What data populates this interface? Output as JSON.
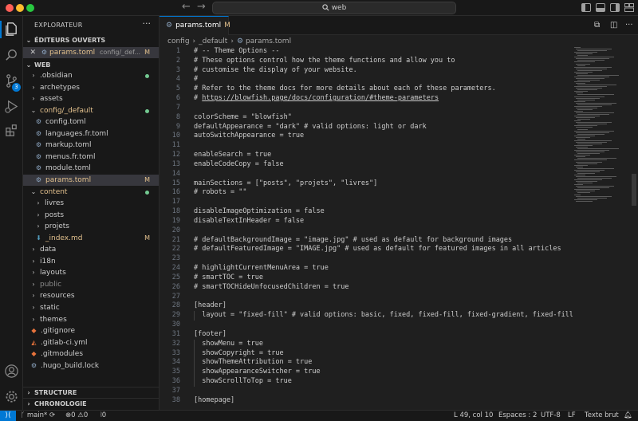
{
  "title_bar": {
    "search_text": "web"
  },
  "activity_bar": {
    "scm_badge": "3"
  },
  "sidebar": {
    "header": "EXPLORATEUR",
    "more": "···",
    "open_editors": {
      "title": "ÉDITEURS OUVERTS",
      "items": [
        {
          "name": "params.toml",
          "path": "config/_def...",
          "status": "M"
        }
      ]
    },
    "workspace": {
      "title": "WEB",
      "tree": [
        {
          "name": ".obsidian",
          "kind": "folder",
          "dot": true
        },
        {
          "name": "archetypes",
          "kind": "folder"
        },
        {
          "name": "assets",
          "kind": "folder"
        },
        {
          "name": "config/_default",
          "kind": "folder-open",
          "dot": true,
          "modified": true
        },
        {
          "name": "config.toml",
          "kind": "file",
          "level": 1
        },
        {
          "name": "languages.fr.toml",
          "kind": "file",
          "level": 1
        },
        {
          "name": "markup.toml",
          "kind": "file",
          "level": 1
        },
        {
          "name": "menus.fr.toml",
          "kind": "file",
          "level": 1
        },
        {
          "name": "module.toml",
          "kind": "file",
          "level": 1
        },
        {
          "name": "params.toml",
          "kind": "file",
          "level": 1,
          "status": "M",
          "selected": true
        },
        {
          "name": "content",
          "kind": "folder-open",
          "dot": true,
          "modified": true
        },
        {
          "name": "livres",
          "kind": "folder",
          "level": 1
        },
        {
          "name": "posts",
          "kind": "folder",
          "level": 1
        },
        {
          "name": "projets",
          "kind": "folder",
          "level": 1
        },
        {
          "name": "_index.md",
          "kind": "md",
          "level": 1,
          "status": "M"
        },
        {
          "name": "data",
          "kind": "folder"
        },
        {
          "name": "i18n",
          "kind": "folder"
        },
        {
          "name": "layouts",
          "kind": "folder"
        },
        {
          "name": "public",
          "kind": "folder",
          "dim": true
        },
        {
          "name": "resources",
          "kind": "folder"
        },
        {
          "name": "static",
          "kind": "folder"
        },
        {
          "name": "themes",
          "kind": "folder"
        },
        {
          "name": ".gitignore",
          "kind": "git"
        },
        {
          "name": ".gitlab-ci.yml",
          "kind": "gitlab"
        },
        {
          "name": ".gitmodules",
          "kind": "git"
        },
        {
          "name": ".hugo_build.lock",
          "kind": "file"
        }
      ]
    },
    "outline": "STRUCTURE",
    "timeline": "CHRONOLOGIE"
  },
  "editor": {
    "tab": {
      "label": "params.toml",
      "status": "M"
    },
    "breadcrumb": [
      "config",
      "_default",
      "params.toml"
    ],
    "lines": [
      {
        "n": "1",
        "t": "# -- Theme Options --"
      },
      {
        "n": "2",
        "t": "# These options control how the theme functions and allow you to"
      },
      {
        "n": "3",
        "t": "# customise the display of your website."
      },
      {
        "n": "4",
        "t": "#"
      },
      {
        "n": "5",
        "t": "# Refer to the theme docs for more details about each of these parameters."
      },
      {
        "n": "6",
        "t": "# ",
        "url": "https://blowfish.page/docs/configuration/#theme-parameters"
      },
      {
        "n": "7",
        "t": ""
      },
      {
        "n": "8",
        "t": "colorScheme = \"blowfish\""
      },
      {
        "n": "9",
        "t": "defaultAppearance = \"dark\" # valid options: light or dark"
      },
      {
        "n": "10",
        "t": "autoSwitchAppearance = true"
      },
      {
        "n": "11",
        "t": ""
      },
      {
        "n": "12",
        "t": "enableSearch = true"
      },
      {
        "n": "13",
        "t": "enableCodeCopy = false"
      },
      {
        "n": "14",
        "t": ""
      },
      {
        "n": "15",
        "t": "mainSections = [\"posts\", \"projets\", \"livres\"]"
      },
      {
        "n": "16",
        "t": "# robots = \"\""
      },
      {
        "n": "17",
        "t": ""
      },
      {
        "n": "18",
        "t": "disableImageOptimization = false"
      },
      {
        "n": "19",
        "t": "disableTextInHeader = false"
      },
      {
        "n": "20",
        "t": ""
      },
      {
        "n": "21",
        "t": "# defaultBackgroundImage = \"image.jpg\" # used as default for background images"
      },
      {
        "n": "22",
        "t": "# defaultFeaturedImage = \"IMAGE.jpg\" # used as default for featured images in all articles"
      },
      {
        "n": "23",
        "t": ""
      },
      {
        "n": "24",
        "t": "# highlightCurrentMenuArea = true"
      },
      {
        "n": "25",
        "t": "# smartTOC = true"
      },
      {
        "n": "26",
        "t": "# smartTOCHideUnfocusedChildren = true"
      },
      {
        "n": "27",
        "t": ""
      },
      {
        "n": "28",
        "t": "[header]"
      },
      {
        "n": "29",
        "t": "  layout = \"fixed-fill\" # valid options: basic, fixed, fixed-fill, fixed-gradient, fixed-fill-blur",
        "indent": true
      },
      {
        "n": "30",
        "t": ""
      },
      {
        "n": "31",
        "t": "[footer]"
      },
      {
        "n": "32",
        "t": "  showMenu = true",
        "indent": true
      },
      {
        "n": "33",
        "t": "  showCopyright = true",
        "indent": true
      },
      {
        "n": "34",
        "t": "  showThemeAttribution = true",
        "indent": true
      },
      {
        "n": "35",
        "t": "  showAppearanceSwitcher = true",
        "indent": true
      },
      {
        "n": "36",
        "t": "  showScrollToTop = true",
        "indent": true
      },
      {
        "n": "37",
        "t": ""
      },
      {
        "n": "38",
        "t": "[homepage]"
      }
    ]
  },
  "status_bar": {
    "branch": "main*",
    "errors": "0",
    "warnings": "0",
    "ports": "0",
    "cursor": "L 49, col 10",
    "indent": "Espaces : 2",
    "encoding": "UTF-8",
    "eol": "LF",
    "language": "Texte brut"
  },
  "colors": {
    "accent": "#0078d4",
    "modified": "#e2c08d",
    "untracked_dot": "#73c991"
  }
}
